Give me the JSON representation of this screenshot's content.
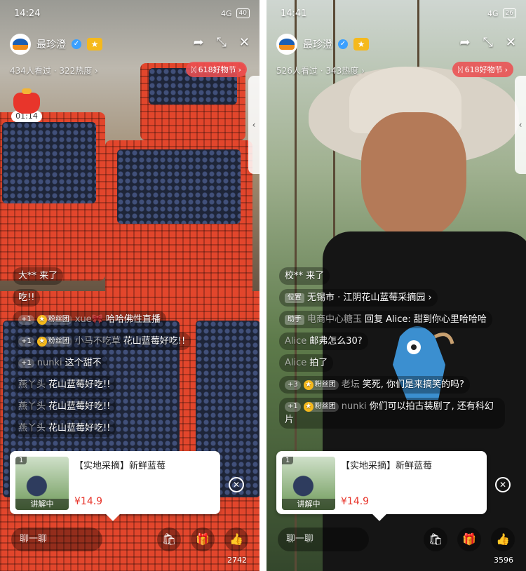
{
  "left": {
    "status": {
      "time": "14:24",
      "battery": "40",
      "network": "4G"
    },
    "host": {
      "name": "最珍澄"
    },
    "stats": {
      "viewers": "434人看过",
      "heat": "322热度"
    },
    "promo": "618好物节",
    "redpacket_timer": "01:14",
    "comments": [
      {
        "type": "system",
        "text": "大** 来了"
      },
      {
        "type": "plain",
        "text": "吃!!"
      },
      {
        "type": "fan",
        "level": "+1",
        "badge": "粉丝团",
        "user": "xue🎀",
        "text": "哈哈佛性直播"
      },
      {
        "type": "fan",
        "level": "+1",
        "badge": "粉丝团",
        "user": "小马不吃草",
        "text": "花山蓝莓好吃!!"
      },
      {
        "type": "level",
        "level": "+1",
        "user": "nunki",
        "text": "这个甜不"
      },
      {
        "type": "user",
        "user": "燕丫头",
        "text": "花山蓝莓好吃!!"
      },
      {
        "type": "user",
        "user": "燕丫头",
        "text": "花山蓝莓好吃!!"
      },
      {
        "type": "user",
        "user": "燕丫头",
        "text": "花山蓝莓好吃!!"
      }
    ],
    "product": {
      "index": "1",
      "title": "【实地采摘】新鲜蓝莓",
      "price": "¥14.9",
      "status": "讲解中"
    },
    "chat_placeholder": "聊一聊",
    "likes": "2742"
  },
  "right": {
    "status": {
      "time": "14:41",
      "battery": "26",
      "network": "4G"
    },
    "host": {
      "name": "最珍澄"
    },
    "stats": {
      "viewers": "526人看过",
      "heat": "343热度"
    },
    "promo": "618好物节",
    "comments": [
      {
        "type": "system",
        "text": "校** 来了"
      },
      {
        "type": "location",
        "tag": "位置",
        "text": "无锡市 · 江阴花山蓝莓采摘园"
      },
      {
        "type": "helper",
        "tag": "助手",
        "user": "电商中心糖玉",
        "text": "回复 Alice: 甜到你心里哈哈哈"
      },
      {
        "type": "user",
        "user": "Alice",
        "text": "邮弗怎么30?"
      },
      {
        "type": "user",
        "user": "Alice",
        "text": "拍了"
      },
      {
        "type": "fan",
        "level": "+3",
        "badge": "粉丝团",
        "user": "老坛",
        "text": "笑死, 你们是来搞笑的吗?"
      },
      {
        "type": "fan",
        "level": "+1",
        "badge": "粉丝团",
        "user": "nunki",
        "text": "你们可以拍古装剧了, 还有科幻片"
      }
    ],
    "product": {
      "index": "1",
      "title": "【实地采摘】新鲜蓝莓",
      "price": "¥14.9",
      "status": "讲解中"
    },
    "chat_placeholder": "聊一聊",
    "likes": "3596"
  },
  "icons": [
    "share-icon",
    "shrink-icon",
    "close-icon",
    "shopping-bag-icon",
    "gift-icon",
    "thumbs-up-icon",
    "chevron-left-icon"
  ]
}
